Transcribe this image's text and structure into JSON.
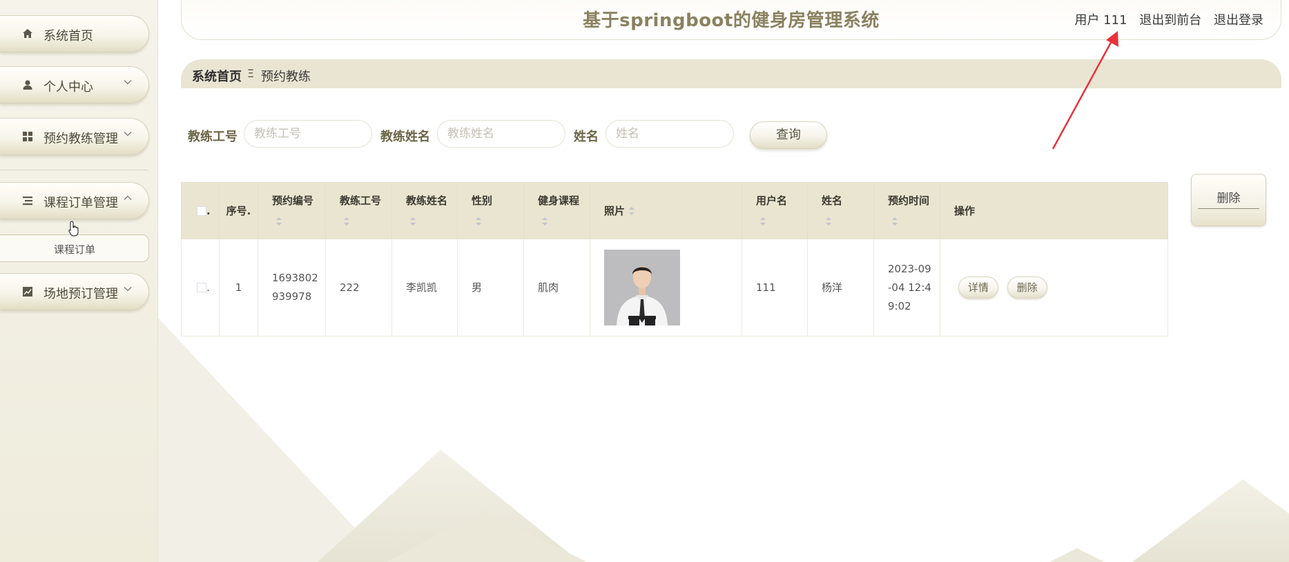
{
  "app": {
    "title": "基于springboot的健身房管理系统",
    "user_label": "用户 111",
    "to_frontend": "退出到前台",
    "logout": "退出登录"
  },
  "sidebar": {
    "items": [
      {
        "label": "系统首页",
        "icon": "home-icon"
      },
      {
        "label": "个人中心",
        "icon": "user-icon",
        "expanded": false
      },
      {
        "label": "预约教练管理",
        "icon": "grid-icon",
        "expanded": false
      },
      {
        "label": "课程订单管理",
        "icon": "list-icon",
        "expanded": true
      },
      {
        "label": "场地预订管理",
        "icon": "chart-icon",
        "expanded": false
      }
    ],
    "submenu": {
      "label": "课程订单"
    }
  },
  "breadcrumb": {
    "home": "系统首页",
    "separator": "Ξ",
    "current": "预约教练"
  },
  "search": {
    "fields": [
      {
        "label": "教练工号",
        "placeholder": "教练工号",
        "value": ""
      },
      {
        "label": "教练姓名",
        "placeholder": "教练姓名",
        "value": ""
      },
      {
        "label": "姓名",
        "placeholder": "姓名",
        "value": ""
      }
    ],
    "query_button": "查询"
  },
  "toolbar": {
    "delete_button": "删除"
  },
  "table": {
    "columns": [
      {
        "key": "select",
        "label": "."
      },
      {
        "key": "index",
        "label": "序号."
      },
      {
        "key": "booking_no",
        "label": "预约编号"
      },
      {
        "key": "coach_id",
        "label": "教练工号"
      },
      {
        "key": "coach_name",
        "label": "教练姓名"
      },
      {
        "key": "gender",
        "label": "性别"
      },
      {
        "key": "course",
        "label": "健身课程"
      },
      {
        "key": "photo",
        "label": "照片"
      },
      {
        "key": "username",
        "label": "用户名"
      },
      {
        "key": "name",
        "label": "姓名"
      },
      {
        "key": "booking_time",
        "label": "预约时间"
      },
      {
        "key": "actions",
        "label": "操作"
      }
    ],
    "rows": [
      {
        "select": ".",
        "index": "1",
        "booking_no": "1693802939978",
        "coach_id": "222",
        "coach_name": "李凯凯",
        "gender": "男",
        "course": "肌肉",
        "username": "111",
        "name": "杨洋",
        "booking_time": "2023-09-04 12:49:02",
        "detail_button": "详情",
        "delete_button": "删除"
      }
    ]
  },
  "colors": {
    "accent_title": "#8a8160",
    "header_bg": "#e9e5d1",
    "sidebar_bg": "#f2f0e4",
    "annotation_arrow": "#e8323c"
  }
}
